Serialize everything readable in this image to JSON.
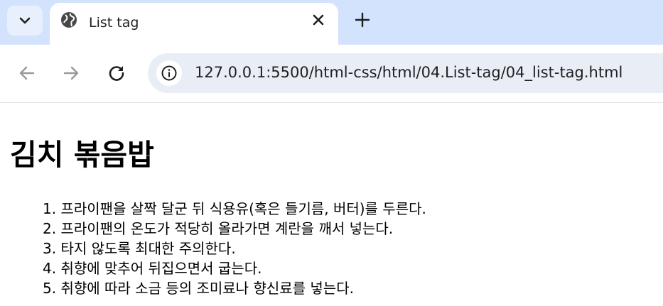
{
  "browser": {
    "tab": {
      "title": "List tag",
      "favicon": "globe-icon"
    },
    "address_bar": {
      "url": "127.0.0.1:5500/html-css/html/04.List-tag/04_list-tag.html"
    },
    "colors": {
      "tabstrip": "#d3e3fd",
      "omnibox": "#e9eef6"
    }
  },
  "page": {
    "title": "김치 볶음밥",
    "list": [
      {
        "number": "1.",
        "text": "프라이팬을 살짝 달군 뒤 식용유(혹은 들기름, 버터)를 두른다."
      },
      {
        "number": "2.",
        "text": "프라이팬의 온도가 적당히 올라가면 계란을 깨서 넣는다."
      },
      {
        "number": "3.",
        "text": "타지 않도록 최대한 주의한다."
      },
      {
        "number": "4.",
        "text": "취향에 맞추어 뒤집으면서 굽는다."
      },
      {
        "number": "5.",
        "text": "취향에 따라 소금 등의 조미료나 향신료를 넣는다."
      }
    ]
  }
}
